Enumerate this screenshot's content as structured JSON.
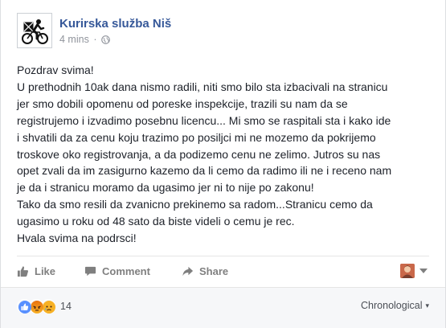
{
  "post": {
    "page_name": "Kurirska služba Niš",
    "timestamp": "4 mins",
    "separator": "·",
    "body_lines": [
      "Pozdrav svima!",
      "U prethodnih 10ak dana nismo radili, niti smo bilo sta izbacivali na stranicu",
      "jer smo dobili opomenu od poreske inspekcije, trazili su nam da se",
      "registrujemo i izvadimo posebnu licencu... Mi smo se raspitali sta i kako ide",
      "i shvatili da za cenu koju trazimo po posiljci mi ne mozemo da pokrijemo",
      "troskove oko registrovanja, a da podizemo cenu ne zelimo. Jutros su nas",
      "opet zvali da im zasigurno kazemo da li cemo da radimo ili ne i receno nam",
      "je da i stranicu moramo da ugasimo jer ni to nije po zakonu!",
      "Tako da smo resili da zvanicno prekinemo sa radom...Stranicu cemo da",
      "ugasimo u roku od 48 sato da biste videli o cemu je rec.",
      "Hvala svima na podrsci!"
    ]
  },
  "actions": {
    "like": "Like",
    "comment": "Comment",
    "share": "Share"
  },
  "footer": {
    "reaction_icons": [
      "like-reaction",
      "angry-reaction",
      "sad-reaction"
    ],
    "reaction_count": "14",
    "sort_label": "Chronological",
    "sort_caret": "▾"
  },
  "colors": {
    "link_blue": "#365899",
    "like_blue": "#5890ff",
    "angry_orange": "#e9710f",
    "sad_yellow": "#f7b125",
    "text": "#1d2129",
    "muted": "#90949c"
  },
  "icons": {
    "avatar": "cyclist-logo",
    "privacy": "globe-icon",
    "like": "thumbs-up-icon",
    "comment": "speech-bubble-icon",
    "share": "share-arrow-icon",
    "switch": "caret-down-icon"
  }
}
